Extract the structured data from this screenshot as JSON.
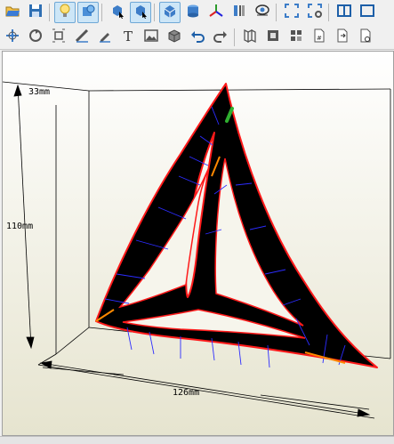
{
  "toolbar": {
    "row1": [
      {
        "name": "open-icon",
        "tip": "open"
      },
      {
        "name": "save-icon",
        "tip": "save"
      },
      {
        "sep": true
      },
      {
        "name": "bulb-icon",
        "active": true
      },
      {
        "name": "texture-icon",
        "active": true
      },
      {
        "sep": true
      },
      {
        "name": "select-front-icon"
      },
      {
        "name": "select-back-icon",
        "active": true
      },
      {
        "sep": true
      },
      {
        "name": "view-3d-icon",
        "active": true
      },
      {
        "name": "cylinder-icon"
      },
      {
        "name": "axis-icon"
      },
      {
        "name": "panel-icon"
      },
      {
        "name": "eye-icon"
      },
      {
        "sep": true
      },
      {
        "name": "fit-icon"
      },
      {
        "name": "fit-settings-icon"
      },
      {
        "sep": true
      },
      {
        "name": "split-view-icon"
      },
      {
        "name": "single-view-icon"
      }
    ],
    "row2": [
      {
        "name": "rotate-icon"
      },
      {
        "name": "orbit-icon"
      },
      {
        "name": "scale-icon"
      },
      {
        "name": "ruler-icon"
      },
      {
        "name": "pen-icon"
      },
      {
        "name": "text-tool-icon"
      },
      {
        "name": "image-icon"
      },
      {
        "name": "box-icon"
      },
      {
        "name": "undo-icon"
      },
      {
        "name": "redo-icon"
      },
      {
        "sep": true
      },
      {
        "name": "unfold-icon"
      },
      {
        "name": "frame-icon"
      },
      {
        "name": "pattern-icon"
      },
      {
        "name": "page-number-icon"
      },
      {
        "name": "export-page-icon"
      },
      {
        "name": "page-settings-icon"
      }
    ]
  },
  "dimensions": {
    "depth": "33mm",
    "height": "110mm",
    "width": "126mm"
  },
  "colors": {
    "outline": "#ff0000",
    "fill": "#000000",
    "fold_line": "#2c2cff",
    "glue_edge": "#ff8800",
    "selected_edge": "#2fae2f"
  }
}
